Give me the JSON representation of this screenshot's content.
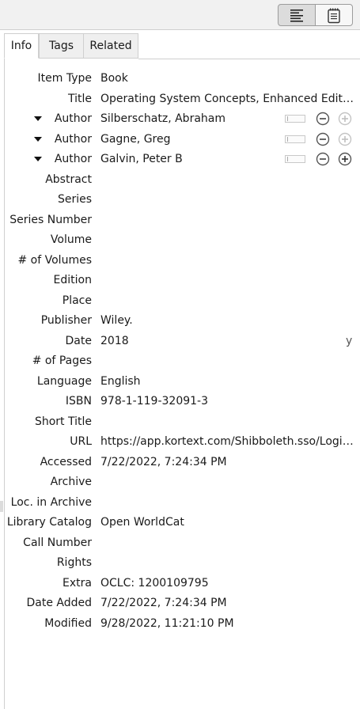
{
  "toolbar": {
    "left_icon": "item-pane-lines-icon",
    "right_icon": "notes-pane-icon"
  },
  "tabs": [
    {
      "label": "Info",
      "active": true
    },
    {
      "label": "Tags",
      "active": false
    },
    {
      "label": "Related",
      "active": false
    }
  ],
  "fields": {
    "item_type": {
      "label": "Item Type",
      "value": "Book"
    },
    "title": {
      "label": "Title",
      "value": "Operating System Concepts, Enhanced Edition."
    },
    "authors": [
      {
        "label": "Author",
        "value": "Silberschatz, Abraham"
      },
      {
        "label": "Author",
        "value": "Gagne, Greg"
      },
      {
        "label": "Author",
        "value": "Galvin, Peter B"
      }
    ],
    "abstract": {
      "label": "Abstract",
      "value": ""
    },
    "series": {
      "label": "Series",
      "value": ""
    },
    "series_number": {
      "label": "Series Number",
      "value": ""
    },
    "volume": {
      "label": "Volume",
      "value": ""
    },
    "num_volumes": {
      "label": "# of Volumes",
      "value": ""
    },
    "edition": {
      "label": "Edition",
      "value": ""
    },
    "place": {
      "label": "Place",
      "value": ""
    },
    "publisher": {
      "label": "Publisher",
      "value": "Wiley."
    },
    "date": {
      "label": "Date",
      "value": "2018",
      "format_hint": "y"
    },
    "num_pages": {
      "label": "# of Pages",
      "value": ""
    },
    "language": {
      "label": "Language",
      "value": "English"
    },
    "isbn": {
      "label": "ISBN",
      "value": "978-1-119-32091-3"
    },
    "short_title": {
      "label": "Short Title",
      "value": ""
    },
    "url": {
      "label": "URL",
      "value": "https://app.kortext.com/Shibboleth.sso/Login?..."
    },
    "accessed": {
      "label": "Accessed",
      "value": "7/22/2022, 7:24:34 PM"
    },
    "archive": {
      "label": "Archive",
      "value": ""
    },
    "loc_in_archive": {
      "label": "Loc. in Archive",
      "value": ""
    },
    "library_catalog": {
      "label": "Library Catalog",
      "value": "Open WorldCat"
    },
    "call_number": {
      "label": "Call Number",
      "value": ""
    },
    "rights": {
      "label": "Rights",
      "value": ""
    },
    "extra": {
      "label": "Extra",
      "value": "OCLC: 1200109795"
    },
    "date_added": {
      "label": "Date Added",
      "value": "7/22/2022, 7:24:34 PM"
    },
    "modified": {
      "label": "Modified",
      "value": "9/28/2022, 11:21:10 PM"
    }
  }
}
